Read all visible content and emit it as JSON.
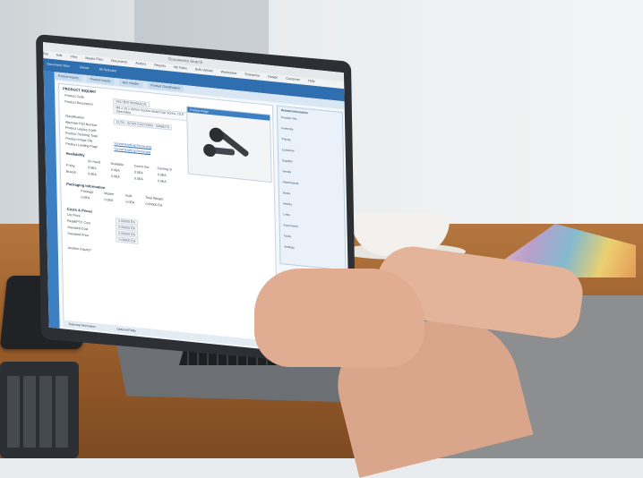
{
  "screen": {
    "window_title": "Documents Search",
    "menu": [
      "File",
      "Edit",
      "View",
      "Master Files",
      "Documents",
      "Actions",
      "Reports",
      "My Tasks",
      "Bulk Upload",
      "Workspace",
      "Enterprise",
      "Design",
      "Customer",
      "Help"
    ],
    "toolbar": [
      "Document View",
      "Viewer",
      "All Selected"
    ],
    "tabs": [
      "Product Inquiry",
      "Product Inquiry",
      "Item Header",
      "Product Classification"
    ],
    "panel_title": "PRODUCT INQUIRY",
    "fields": [
      {
        "label": "Product Code",
        "value": "SKU-BNI-0034AA101"
      },
      {
        "label": "Product Description",
        "value": "M8 x 20 x 40mm Socket Head Cap Screw, 10.9 Steel Alloy"
      },
      {
        "label": "Classification",
        "value": "CLTN - SCM3 CUSTOMS - 04/99270"
      },
      {
        "label": "Alternate Part Number",
        "value": ""
      },
      {
        "label": "Product Legacy Code",
        "value": ""
      },
      {
        "label": "Product Stocking Type",
        "value": ""
      },
      {
        "label": "Product Image File",
        "value": ""
      },
      {
        "label": "Product Landing Page",
        "value": ""
      }
    ],
    "links": [
      "ScrewHeadCapScrew.png",
      "ScrewHeadCapScrew.jpg"
    ],
    "availability": {
      "title": "Availability",
      "headers": [
        "On Hand",
        "Available",
        "Comm Est",
        "Coming In"
      ],
      "rows": [
        {
          "label": "P-Wty",
          "values": [
            "0.0EA",
            "0.0EA",
            "0.0EA",
            "0.0EA"
          ]
        },
        {
          "label": "Branch",
          "values": [
            "0.0EA",
            "0.0EA",
            "0.0EA",
            "0.0EA"
          ]
        }
      ]
    },
    "packaging": {
      "title": "Packaging Information",
      "headers": [
        "Package",
        "Master",
        "Bulk",
        "Total Weight"
      ],
      "values": [
        "0.0EA",
        "0.0EA",
        "0.0EA",
        "0.00000 EA"
      ]
    },
    "costs": {
      "title": "Costs & Prices",
      "rows": [
        {
          "label": "List Price",
          "value": "0.00000 EA"
        },
        {
          "label": "Retail/PTC Cost",
          "value": "0.00000 EA"
        },
        {
          "label": "Standard Cost",
          "value": "0.00000 EA"
        },
        {
          "label": "Standard Price",
          "value": "0.00000 EA"
        }
      ]
    },
    "another_inquiry": "Another Inquiry?",
    "status": [
      "Technical Information",
      "Optional Fields"
    ],
    "preview_title": "Product Image",
    "side_title": "Related Information",
    "side_items": [
      "Product Info",
      "Inventory",
      "Pricing",
      "Customer",
      "Supplier",
      "Vendor",
      "Attachments",
      "Notes",
      "History",
      "Links",
      "Documents",
      "Tasks",
      "Settings"
    ]
  },
  "colors": {
    "toolbar": "#2f6fb0",
    "rail": "#3c7fc2",
    "desk": "#9b5f2c",
    "lid": "#2c2f33"
  }
}
